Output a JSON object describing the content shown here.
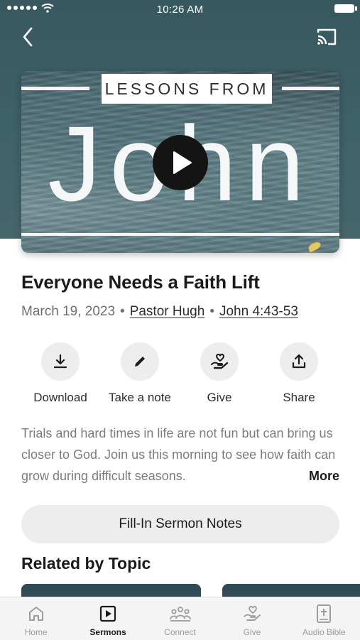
{
  "status_bar": {
    "time": "10:26 AM"
  },
  "artwork": {
    "series_label": "LESSONS FROM",
    "series_title": "John"
  },
  "sermon": {
    "title": "Everyone Needs a Faith Lift",
    "date": "March 19, 2023",
    "speaker": "Pastor Hugh",
    "scripture": "John 4:43-53",
    "description": "Trials and hard times in life are not fun but can bring us closer to God. Join us this morning to see how faith can grow during difficult seasons.",
    "more_label": "More"
  },
  "actions": [
    {
      "label": "Download",
      "icon": "download-icon"
    },
    {
      "label": "Take a note",
      "icon": "pencil-icon"
    },
    {
      "label": "Give",
      "icon": "heart-hand-icon"
    },
    {
      "label": "Share",
      "icon": "share-icon"
    }
  ],
  "notes_button": {
    "label": "Fill-In Sermon Notes"
  },
  "related": {
    "title": "Related by Topic"
  },
  "tabs": [
    {
      "label": "Home",
      "icon": "home-icon",
      "active": false
    },
    {
      "label": "Sermons",
      "icon": "play-square-icon",
      "active": true
    },
    {
      "label": "Connect",
      "icon": "people-icon",
      "active": false
    },
    {
      "label": "Give",
      "icon": "heart-hand-icon",
      "active": false
    },
    {
      "label": "Audio Bible",
      "icon": "bible-icon",
      "active": false
    }
  ],
  "colors": {
    "header_bg": "#3f6168",
    "active_tab": "#1c1c1e",
    "inactive_tab": "#9a9c9f"
  }
}
